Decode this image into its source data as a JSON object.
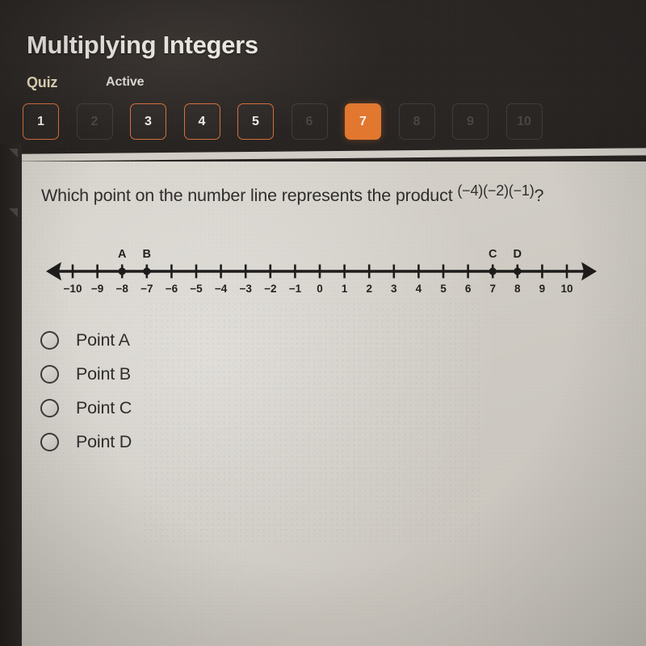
{
  "header": {
    "title": "Multiplying Integers",
    "section_label": "Quiz",
    "status_label": "Active",
    "accent_color": "#e2772f",
    "background_color": "#2a2624",
    "title_color": "#e9e6e1",
    "section_label_color": "#e3d6b8"
  },
  "question_nav": {
    "buttons": [
      {
        "label": "1",
        "state": "answered"
      },
      {
        "label": "2",
        "state": "locked"
      },
      {
        "label": "3",
        "state": "answered"
      },
      {
        "label": "4",
        "state": "answered"
      },
      {
        "label": "5",
        "state": "answered"
      },
      {
        "label": "6",
        "state": "locked"
      },
      {
        "label": "7",
        "state": "current"
      },
      {
        "label": "8",
        "state": "locked"
      },
      {
        "label": "9",
        "state": "locked"
      },
      {
        "label": "10",
        "state": "locked"
      }
    ]
  },
  "question": {
    "prompt": "Which point on the number line represents the product",
    "expression": "(−4)(−2)(−1)",
    "terminator": "?"
  },
  "options": [
    {
      "label": "Point A",
      "selected": false
    },
    {
      "label": "Point B",
      "selected": false
    },
    {
      "label": "Point C",
      "selected": false
    },
    {
      "label": "Point D",
      "selected": false
    }
  ],
  "chart_data": {
    "type": "numberline",
    "title": "",
    "xlabel": "",
    "ylabel": "",
    "axis_min": -10,
    "axis_max": 10,
    "tick_step": 1,
    "tick_labels": [
      "−10",
      "−9",
      "−8",
      "−7",
      "−6",
      "−5",
      "−4",
      "−3",
      "−2",
      "−1",
      "0",
      "1",
      "2",
      "3",
      "4",
      "5",
      "6",
      "7",
      "8",
      "9",
      "10"
    ],
    "tick_values": [
      -10,
      -9,
      -8,
      -7,
      -6,
      -5,
      -4,
      -3,
      -2,
      -1,
      0,
      1,
      2,
      3,
      4,
      5,
      6,
      7,
      8,
      9,
      10
    ],
    "arrows": [
      "left",
      "right"
    ],
    "points": [
      {
        "label": "A",
        "value": -8
      },
      {
        "label": "B",
        "value": -7
      },
      {
        "label": "C",
        "value": 7
      },
      {
        "label": "D",
        "value": 8
      }
    ],
    "line_color": "#1d1c1b",
    "grid": false,
    "legend": "none"
  }
}
